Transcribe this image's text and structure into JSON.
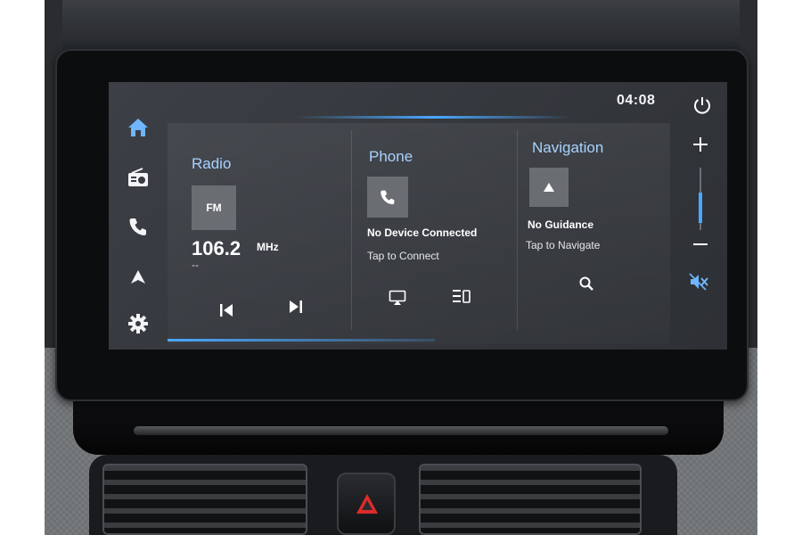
{
  "clock": "04:08",
  "sidebar": {
    "items": [
      {
        "icon": "home-icon"
      },
      {
        "icon": "radio-icon"
      },
      {
        "icon": "phone-icon"
      },
      {
        "icon": "navigation-icon"
      },
      {
        "icon": "gear-icon"
      }
    ]
  },
  "radio": {
    "title": "Radio",
    "band": "FM",
    "frequency": "106.2",
    "unit": "MHz",
    "station": "--"
  },
  "phone": {
    "title": "Phone",
    "status": "No Device Connected",
    "hint": "Tap to Connect"
  },
  "navigation": {
    "title": "Navigation",
    "status": "No Guidance",
    "hint": "Tap to Navigate"
  },
  "right_bar": {
    "volume_level_percent": 45
  },
  "colors": {
    "accent": "#4aa8ff",
    "title": "#a9d2ff",
    "screen_bg": "#383b40"
  }
}
